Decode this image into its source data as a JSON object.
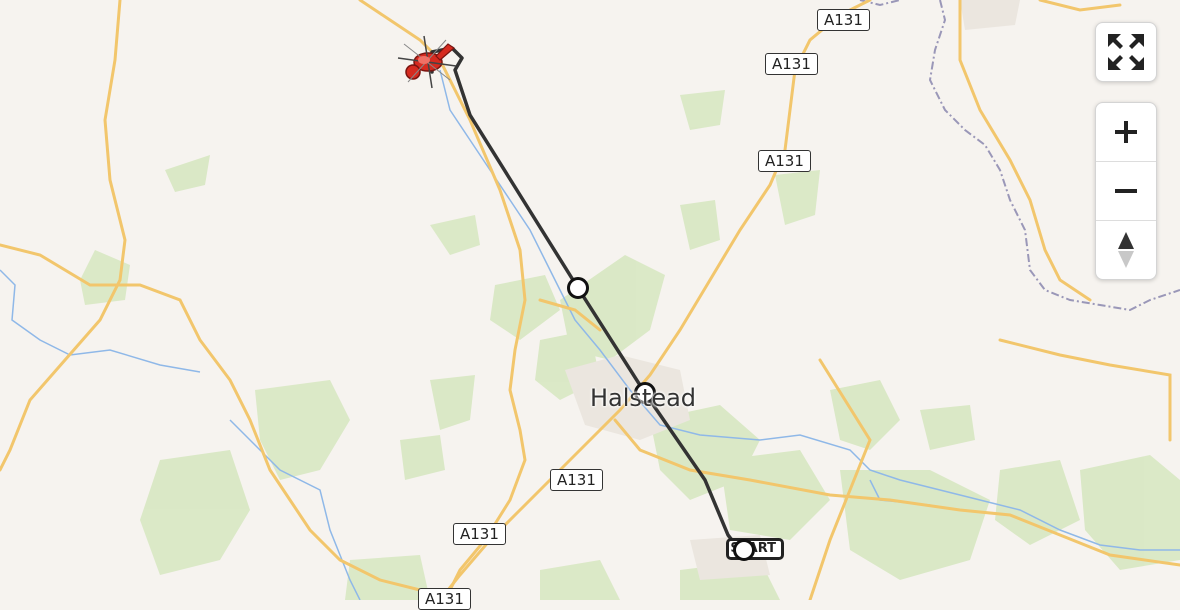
{
  "map": {
    "town": "Halstead",
    "road_shields": [
      "A131",
      "A131",
      "A131",
      "A131",
      "A131",
      "A131"
    ],
    "start_label": "START",
    "route_color": "#333333",
    "destination_marker_color": "#d62b20"
  },
  "controls": {
    "fullscreen_icon": "expand-arrows-icon",
    "zoom_in_symbol": "+",
    "zoom_out_symbol": "−",
    "compass_icon": "north-arrow-icon"
  }
}
